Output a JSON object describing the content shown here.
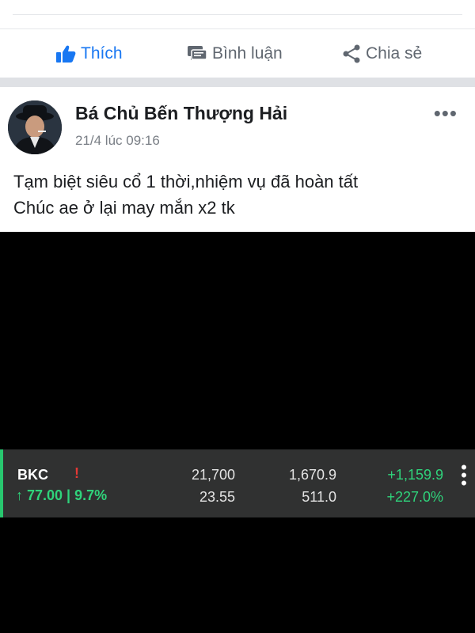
{
  "actions": {
    "like": "Thích",
    "comment": "Bình luận",
    "share": "Chia sẻ"
  },
  "post": {
    "author": "Bá Chủ Bến Thượng Hải",
    "timestamp": "21/4 lúc 09:16",
    "text_line1": "Tạm biệt siêu cổ 1 thời,nhiệm vụ đã hoàn tất",
    "text_line2": "Chúc ae ở lại may mắn x2 tk"
  },
  "stock": {
    "ticker": "BKC",
    "alert": "!",
    "arrow": "↑",
    "change": "77.00 | 9.7%",
    "col1_top": "21,700",
    "col1_bottom": "23.55",
    "col2_top": "1,670.9",
    "col2_bottom": "511.0",
    "col3_top": "+1,159.9",
    "col3_bottom": "+227.0%"
  },
  "colors": {
    "accent": "#1877f2",
    "positive": "#2fd37b",
    "alert": "#e53935"
  },
  "icons": [
    "thumbs-up-icon",
    "comment-icon",
    "share-icon",
    "more-icon",
    "kebab-icon"
  ]
}
